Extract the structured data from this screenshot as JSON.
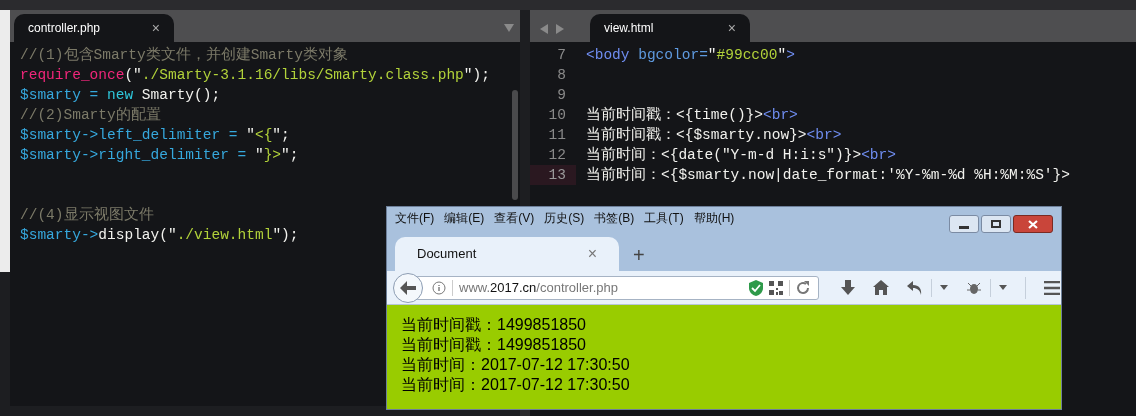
{
  "editor": {
    "left_pane": {
      "tab": {
        "title": "controller.php",
        "close": "×",
        "selected": true
      },
      "lines": [
        {
          "kind": "code",
          "tokens": [
            {
              "kind": "comment",
              "text": "//(1)包含Smarty类文件，并创建Smarty类对象"
            }
          ]
        },
        {
          "kind": "code",
          "tokens": [
            {
              "kind": "function",
              "text": "require_once"
            },
            {
              "kind": "plain",
              "text": "(\""
            },
            {
              "kind": "string",
              "text": "./Smarty-3.1.16/libs/Smarty.class.php"
            },
            {
              "kind": "plain",
              "text": "\");"
            }
          ]
        },
        {
          "kind": "code",
          "tokens": [
            {
              "kind": "variable",
              "text": "$smarty"
            },
            {
              "kind": "operator",
              "text": " = "
            },
            {
              "kind": "keyword",
              "text": "new"
            },
            {
              "kind": "plain",
              "text": " Smarty();"
            }
          ]
        },
        {
          "kind": "code",
          "tokens": [
            {
              "kind": "comment",
              "text": "//(2)Smarty的配置"
            }
          ]
        },
        {
          "kind": "code",
          "tokens": [
            {
              "kind": "variable",
              "text": "$smarty->left_delimiter"
            },
            {
              "kind": "operator",
              "text": " = "
            },
            {
              "kind": "plain",
              "text": "\""
            },
            {
              "kind": "string",
              "text": "<{"
            },
            {
              "kind": "plain",
              "text": "\";"
            }
          ]
        },
        {
          "kind": "code",
          "tokens": [
            {
              "kind": "variable",
              "text": "$smarty->right_delimiter"
            },
            {
              "kind": "operator",
              "text": " = "
            },
            {
              "kind": "plain",
              "text": "\""
            },
            {
              "kind": "string",
              "text": "}>"
            },
            {
              "kind": "plain",
              "text": "\";"
            }
          ]
        },
        {
          "kind": "blank"
        },
        {
          "kind": "blank"
        },
        {
          "kind": "code",
          "tokens": [
            {
              "kind": "comment",
              "text": "//(4)显示视图文件"
            }
          ]
        },
        {
          "kind": "code",
          "tokens": [
            {
              "kind": "variable",
              "text": "$smarty->"
            },
            {
              "kind": "plain",
              "text": "display(\""
            },
            {
              "kind": "string",
              "text": "./view.html"
            },
            {
              "kind": "plain",
              "text": "\");"
            }
          ]
        }
      ]
    },
    "right_pane": {
      "tab": {
        "title": "view.html",
        "close": "×",
        "selected": true
      },
      "lines": [
        {
          "number": "7",
          "current": false,
          "tokens": [
            {
              "kind": "tag",
              "text": "<body "
            },
            {
              "kind": "attribute",
              "text": "bgcolor="
            },
            {
              "kind": "plain",
              "text": "\""
            },
            {
              "kind": "string",
              "text": "#99cc00"
            },
            {
              "kind": "plain",
              "text": "\""
            },
            {
              "kind": "tag",
              "text": ">"
            }
          ]
        },
        {
          "number": "8",
          "current": false
        },
        {
          "number": "9",
          "current": false
        },
        {
          "number": "10",
          "current": false,
          "tokens": [
            {
              "kind": "plain",
              "text": "当前时间戳：<{time()}>"
            },
            {
              "kind": "tag",
              "text": "<br>"
            }
          ]
        },
        {
          "number": "11",
          "current": false,
          "tokens": [
            {
              "kind": "plain",
              "text": "当前时间戳：<{$smarty.now}>"
            },
            {
              "kind": "tag",
              "text": "<br>"
            }
          ]
        },
        {
          "number": "12",
          "current": false,
          "tokens": [
            {
              "kind": "plain",
              "text": "当前时间：<{date(\"Y-m-d H:i:s\")}>"
            },
            {
              "kind": "tag",
              "text": "<br>"
            }
          ]
        },
        {
          "number": "13",
          "current": true,
          "tokens": [
            {
              "kind": "plain",
              "text": "当前时间：<{$smarty.now|date_format:'%Y-%m-%d %H:%M:%S'}>"
            }
          ]
        }
      ]
    }
  },
  "browser": {
    "menu": [
      "文件(F)",
      "编辑(E)",
      "查看(V)",
      "历史(S)",
      "书签(B)",
      "工具(T)",
      "帮助(H)"
    ],
    "tab": {
      "title": "Document",
      "close": "×",
      "selected": true
    },
    "new_tab": "+",
    "address": {
      "prefix": "www.",
      "domain": "2017.cn",
      "path": "/controller.php"
    },
    "content_lines": [
      "当前时间戳：1499851850",
      "当前时间戳：1499851850",
      "当前时间：2017-07-12 17:30:50",
      "当前时间：2017-07-12 17:30:50"
    ]
  }
}
